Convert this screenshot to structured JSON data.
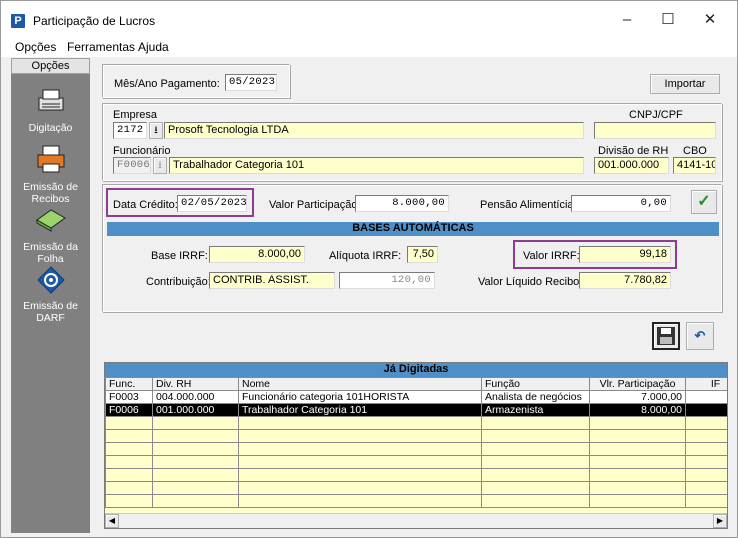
{
  "window": {
    "title": "Participação de Lucros",
    "minimize": "–",
    "maximize": "☐",
    "close": "✕"
  },
  "menu": [
    "Opções",
    "Ferramentas",
    "Ajuda"
  ],
  "sidebar": {
    "header": "Opções",
    "items": [
      {
        "label": "Digitação",
        "icon": "typewriter-icon"
      },
      {
        "label": "Emissão de Recibos",
        "icon": "printer-icon"
      },
      {
        "label": "Emissão da Folha",
        "icon": "sheet-icon"
      },
      {
        "label": "Emissão de DARF",
        "icon": "darf-icon"
      }
    ]
  },
  "form": {
    "mes_ano_label": "Mês/Ano Pagamento:",
    "mes_ano_value": "05/2023",
    "importar": "Importar",
    "empresa_label": "Empresa",
    "empresa_code": "2172",
    "empresa_name": "Prosoft Tecnologia LTDA",
    "cnpj_label": "CNPJ/CPF",
    "cnpj_value": "",
    "funcionario_label": "Funcionário",
    "funcionario_code": "F0006",
    "funcionario_name": "Trabalhador Categoria 101",
    "divisao_label": "Divisão de RH",
    "divisao_value": "001.000.000",
    "cbo_label": "CBO",
    "cbo_value": "4141-10",
    "data_credito_label": "Data Crédito:",
    "data_credito_value": "02/05/2023",
    "valor_participacao_label": "Valor Participação:",
    "valor_participacao_value": "8.000,00",
    "pensao_label": "Pensão Alimentícia:",
    "pensao_value": "0,00",
    "bases_title": "BASES AUTOMÁTICAS",
    "base_irrf_label": "Base IRRF:",
    "base_irrf_value": "8.000,00",
    "aliquota_label": "Alíquota IRRF:",
    "aliquota_value": "7,50",
    "valor_irrf_label": "Valor IRRF:",
    "valor_irrf_value": "99,18",
    "contribuicao_label": "Contribuição:",
    "contribuicao_desc": "CONTRIB. ASSIST.",
    "contribuicao_value": "120,00",
    "liquido_label": "Valor Líquido Recibo:",
    "liquido_value": "7.780,82"
  },
  "grid": {
    "title": "Já Digitadas",
    "columns": [
      "Func.",
      "Div. RH",
      "Nome",
      "Função",
      "Vlr. Participação",
      "IF"
    ],
    "rows": [
      [
        "F0003",
        "004.000.000",
        "Funcionário categoria 101HORISTA",
        "Analista de negócios",
        "7.000,00",
        ""
      ],
      [
        "F0006",
        "001.000.000",
        "Trabalhador Categoria 101",
        "Armazenista",
        "8.000,00",
        ""
      ]
    ],
    "selected_row": 1
  },
  "colors": {
    "highlight_border": "#8e3c93",
    "band": "#4f8fc8",
    "field_yellow": "#ffffcc",
    "sidebar_bg": "#808080"
  }
}
